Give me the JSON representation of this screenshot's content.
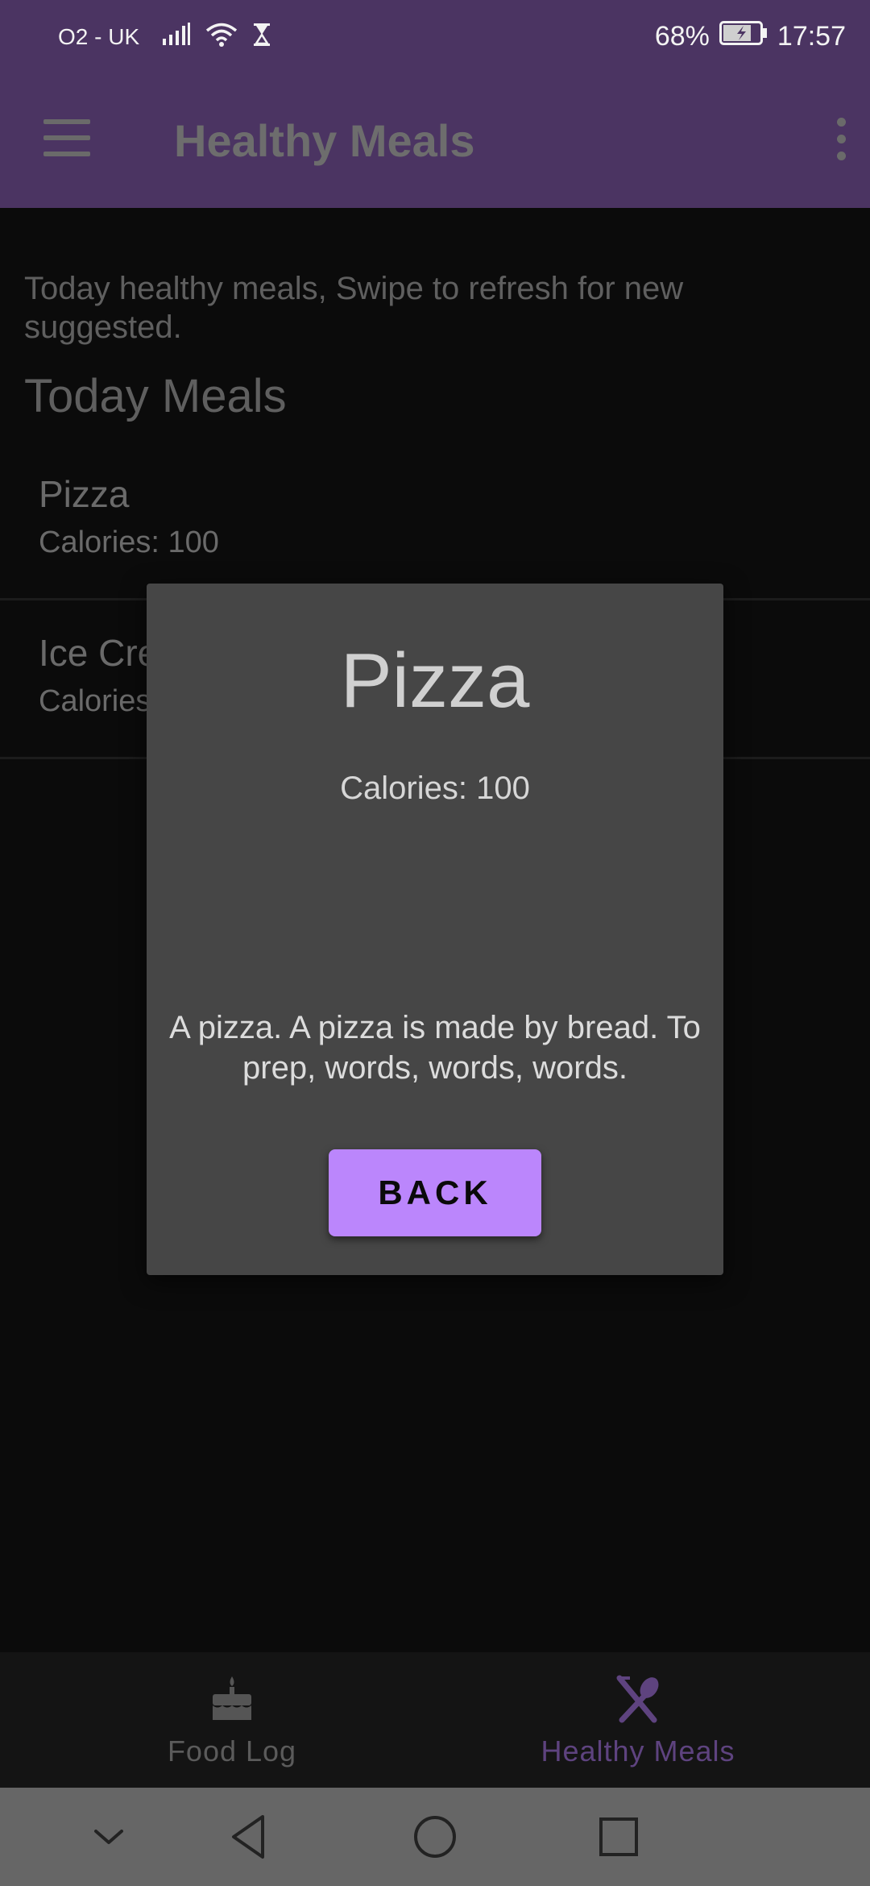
{
  "status_bar": {
    "carrier": "O2 - UK",
    "battery": "68%",
    "time": "17:57"
  },
  "app_bar": {
    "title": "Healthy Meals"
  },
  "content": {
    "intro": "Today healthy meals, Swipe to refresh for new suggested.",
    "section_title": "Today Meals",
    "meals": [
      {
        "name": "Pizza",
        "calories": "Calories: 100"
      },
      {
        "name": "Ice Cre",
        "calories": "Calories"
      }
    ]
  },
  "dialog": {
    "title": "Pizza",
    "calories": "Calories: 100",
    "description": "A pizza. A pizza is made by bread. To prep, words, words, words.",
    "back_label": "BACK",
    "back_color": "#bb86fc"
  },
  "bottom_nav": {
    "items": [
      {
        "label": "Food Log",
        "icon": "cake-icon",
        "active": false
      },
      {
        "label": "Healthy Meals",
        "icon": "cutlery-icon",
        "active": true
      }
    ],
    "active_color": "#5e437f",
    "inactive_color": "#555555"
  },
  "system_nav": {
    "buttons": [
      "collapse-icon",
      "back-icon",
      "home-icon",
      "recents-icon"
    ]
  },
  "colors": {
    "app_bar": "#4b3462",
    "background": "#0b0b0b",
    "dialog": "#464646"
  }
}
